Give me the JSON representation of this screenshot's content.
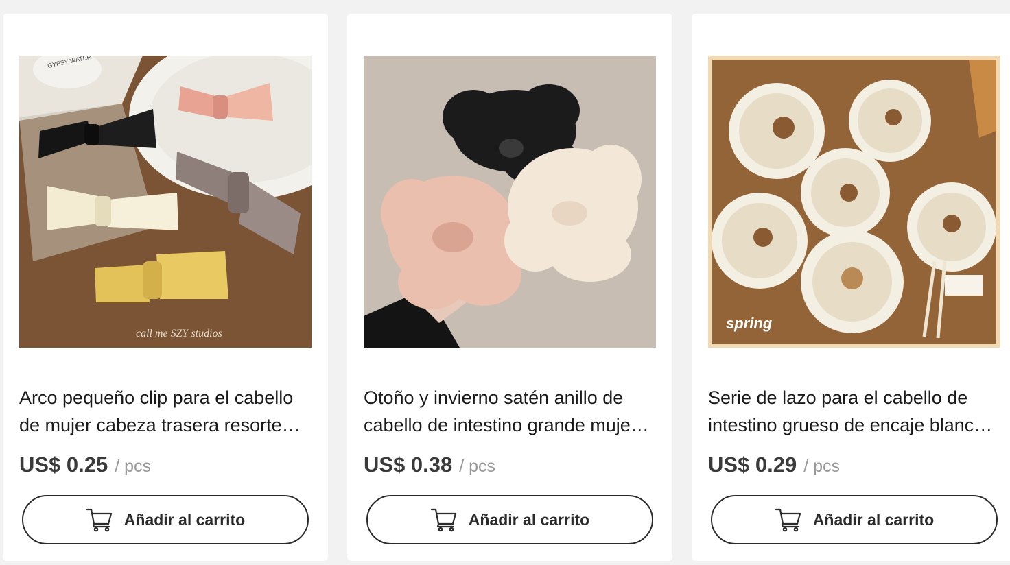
{
  "products": [
    {
      "image": "hair-bows-photo",
      "image_watermark": "call me SZY studios",
      "image_packaging_text": "GYPSY WATER",
      "title": "Arco pequeño clip para el cabello de mujer cabeza trasera resorte…",
      "price": "US$ 0.25",
      "unit": "/ pcs",
      "cart_label": "Añadir al carrito",
      "cart_icon": "cart-icon"
    },
    {
      "image": "satin-scrunchies-photo",
      "title": "Otoño y invierno satén anillo de cabello de intestino grande muje…",
      "price": "US$ 0.38",
      "unit": "/ pcs",
      "cart_label": "Añadir al carrito",
      "cart_icon": "cart-icon"
    },
    {
      "image": "lace-scrunchies-photo",
      "image_caption": "spring",
      "title": "Serie de lazo para el cabello de intestino grueso de encaje blanc…",
      "price": "US$ 0.29",
      "unit": "/ pcs",
      "cart_label": "Añadir al carrito",
      "cart_icon": "cart-icon"
    }
  ]
}
